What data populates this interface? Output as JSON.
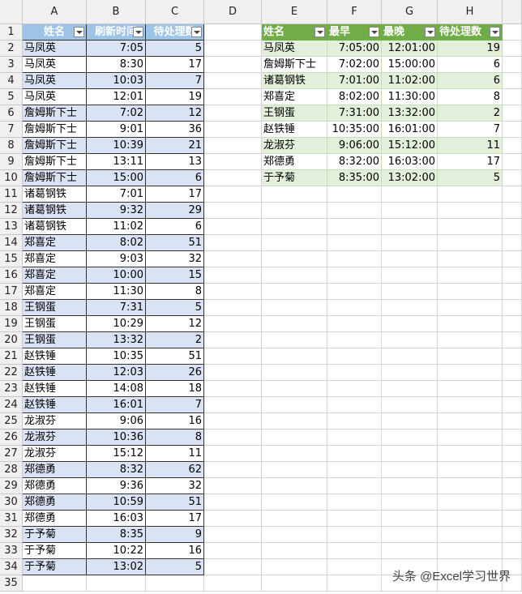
{
  "columns": [
    "A",
    "B",
    "C",
    "D",
    "E",
    "F",
    "G",
    "H"
  ],
  "table1": {
    "headers": [
      "姓名",
      "刷新时间",
      "待处理数"
    ],
    "rows": [
      [
        "马凤英",
        "7:05",
        "5"
      ],
      [
        "马凤英",
        "8:30",
        "17"
      ],
      [
        "马凤英",
        "10:03",
        "7"
      ],
      [
        "马凤英",
        "12:01",
        "19"
      ],
      [
        "詹姆斯下士",
        "7:02",
        "12"
      ],
      [
        "詹姆斯下士",
        "9:01",
        "36"
      ],
      [
        "詹姆斯下士",
        "10:39",
        "21"
      ],
      [
        "詹姆斯下士",
        "13:11",
        "13"
      ],
      [
        "詹姆斯下士",
        "15:00",
        "6"
      ],
      [
        "诸葛钢铁",
        "7:01",
        "17"
      ],
      [
        "诸葛钢铁",
        "9:32",
        "29"
      ],
      [
        "诸葛钢铁",
        "11:02",
        "6"
      ],
      [
        "郑喜定",
        "8:02",
        "51"
      ],
      [
        "郑喜定",
        "9:03",
        "32"
      ],
      [
        "郑喜定",
        "10:00",
        "15"
      ],
      [
        "郑喜定",
        "11:30",
        "8"
      ],
      [
        "王钢蛋",
        "7:31",
        "5"
      ],
      [
        "王钢蛋",
        "10:29",
        "12"
      ],
      [
        "王钢蛋",
        "13:32",
        "2"
      ],
      [
        "赵铁锤",
        "10:35",
        "51"
      ],
      [
        "赵铁锤",
        "12:03",
        "26"
      ],
      [
        "赵铁锤",
        "14:08",
        "18"
      ],
      [
        "赵铁锤",
        "16:01",
        "7"
      ],
      [
        "龙淑芬",
        "9:06",
        "16"
      ],
      [
        "龙淑芬",
        "10:36",
        "8"
      ],
      [
        "龙淑芬",
        "15:12",
        "11"
      ],
      [
        "郑德勇",
        "8:32",
        "62"
      ],
      [
        "郑德勇",
        "9:36",
        "32"
      ],
      [
        "郑德勇",
        "10:59",
        "51"
      ],
      [
        "郑德勇",
        "16:03",
        "17"
      ],
      [
        "于予菊",
        "8:35",
        "9"
      ],
      [
        "于予菊",
        "10:22",
        "16"
      ],
      [
        "于予菊",
        "13:02",
        "5"
      ]
    ]
  },
  "table2": {
    "headers": [
      "姓名",
      "最早",
      "最晚",
      "待处理数"
    ],
    "rows": [
      [
        "马凤英",
        "7:05:00",
        "12:01:00",
        "19"
      ],
      [
        "詹姆斯下士",
        "7:02:00",
        "15:00:00",
        "6"
      ],
      [
        "诸葛钢铁",
        "7:01:00",
        "11:02:00",
        "6"
      ],
      [
        "郑喜定",
        "8:02:00",
        "11:30:00",
        "8"
      ],
      [
        "王钢蛋",
        "7:31:00",
        "13:32:00",
        "2"
      ],
      [
        "赵铁锤",
        "10:35:00",
        "16:01:00",
        "7"
      ],
      [
        "龙淑芬",
        "9:06:00",
        "15:12:00",
        "11"
      ],
      [
        "郑德勇",
        "8:32:00",
        "16:03:00",
        "17"
      ],
      [
        "于予菊",
        "8:35:00",
        "13:02:00",
        "5"
      ]
    ]
  },
  "row_count": 35,
  "watermark": "头条 @Excel学习世界"
}
